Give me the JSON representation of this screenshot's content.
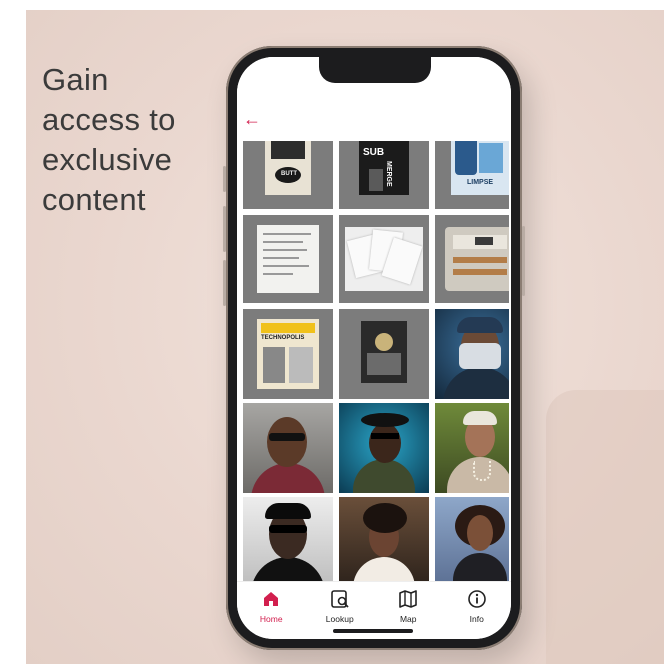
{
  "headline": "Gain\naccess to\nexclusive\ncontent",
  "colors": {
    "accent": "#d21f4e",
    "background": "#ead7cf",
    "phone_frame": "#1c1c1e"
  },
  "nav": {
    "back_icon": "back-arrow-icon",
    "back_glyph": "←"
  },
  "grid": {
    "rows": [
      [
        "poster-the-butt",
        "poster-submerge",
        "poster-glimpse"
      ],
      [
        "document-typed-list",
        "document-papers-stack",
        "drum-machine-photo"
      ],
      [
        "poster-technopolis",
        "poster-black-white",
        "portrait-masked-man"
      ],
      [
        "portrait-man-glasses",
        "portrait-man-hat",
        "portrait-woman-necklace"
      ],
      [
        "portrait-woman-sunglasses",
        "portrait-woman-profile",
        "portrait-woman-afro"
      ]
    ],
    "poster_texts": {
      "submerge_sub": "SUB",
      "submerge_merge": "MERGE",
      "glimpse": "LIMPSE",
      "the_butt": "BUTT",
      "technopolis": "TECHNOPOLIS"
    }
  },
  "tabs": [
    {
      "label": "Home",
      "icon": "home-icon",
      "active": true
    },
    {
      "label": "Lookup",
      "icon": "lookup-icon",
      "active": false
    },
    {
      "label": "Map",
      "icon": "map-icon",
      "active": false
    },
    {
      "label": "Info",
      "icon": "info-icon",
      "active": false
    }
  ]
}
